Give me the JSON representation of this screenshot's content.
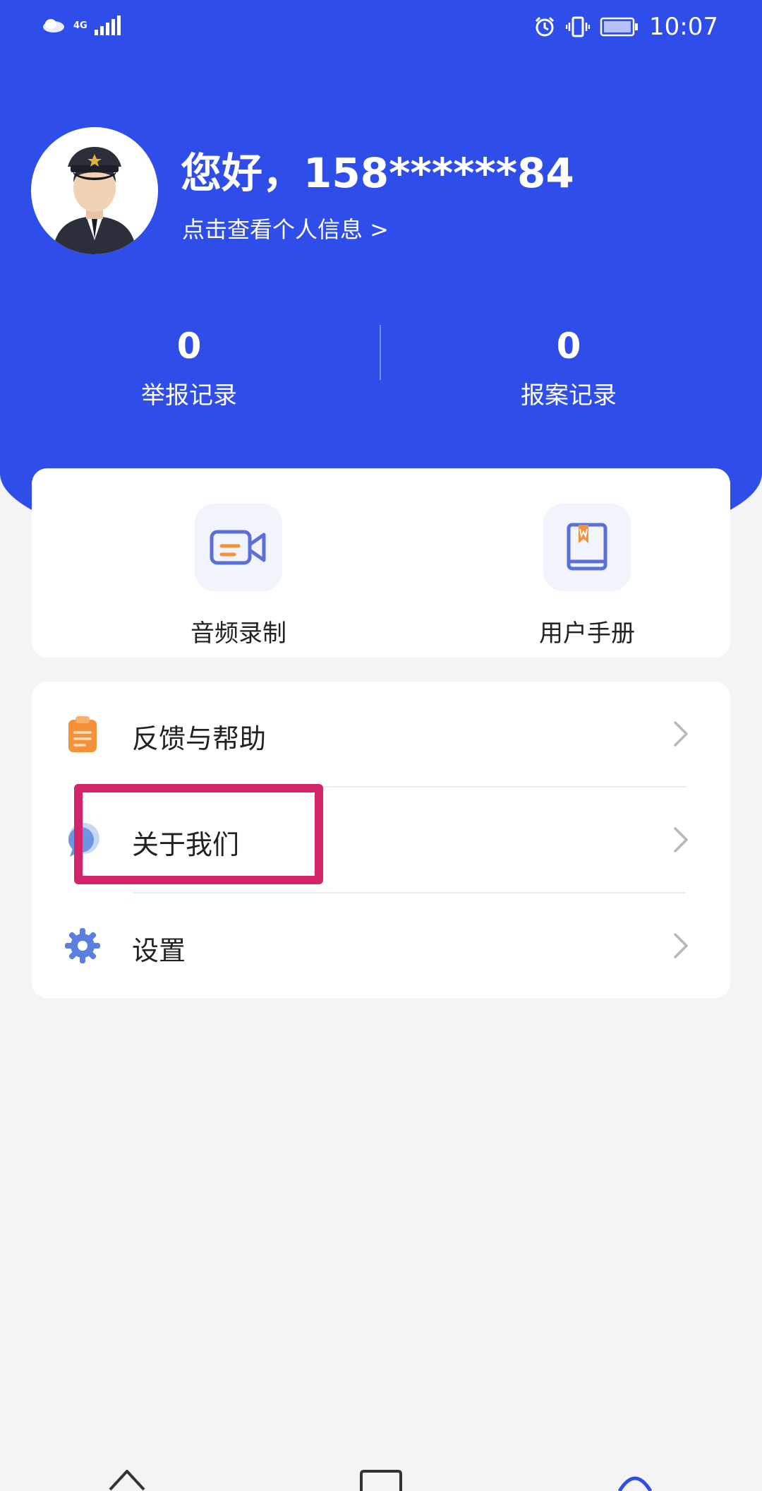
{
  "status_bar": {
    "network": "4G",
    "time": "10:07"
  },
  "profile": {
    "greeting": "您好，158******84",
    "view_info": "点击查看个人信息 >"
  },
  "stats": [
    {
      "value": "0",
      "label": "举报记录"
    },
    {
      "value": "0",
      "label": "报案记录"
    }
  ],
  "tools": [
    {
      "label": "音频录制",
      "icon": "video-camera-icon"
    },
    {
      "label": "用户手册",
      "icon": "book-icon"
    }
  ],
  "menu": [
    {
      "label": "反馈与帮助",
      "icon": "clipboard-icon"
    },
    {
      "label": "关于我们",
      "icon": "chat-bubble-icon"
    },
    {
      "label": "设置",
      "icon": "gear-icon"
    }
  ],
  "colors": {
    "primary": "#2f4de8",
    "highlight": "#d3246a",
    "orange": "#f5913a",
    "icon_blue": "#5b6fd8"
  }
}
